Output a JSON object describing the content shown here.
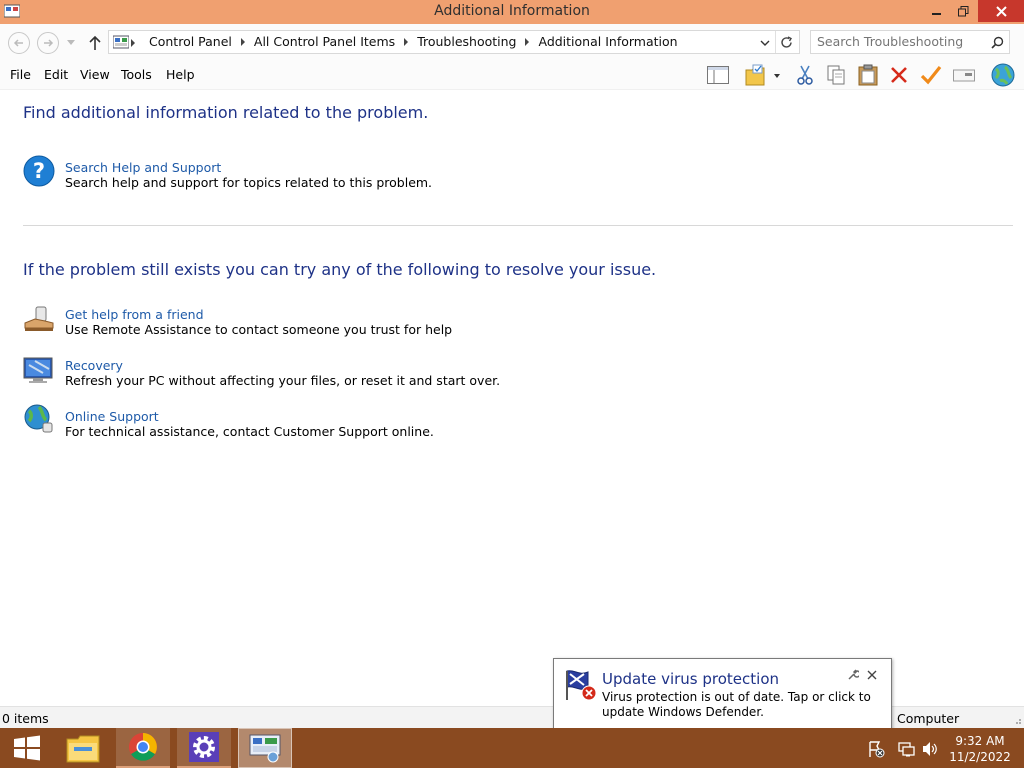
{
  "window": {
    "title": "Additional Information"
  },
  "address": {
    "breadcrumbs": [
      "Control Panel",
      "All Control Panel Items",
      "Troubleshooting",
      "Additional Information"
    ],
    "search_placeholder": "Search Troubleshooting"
  },
  "menu": {
    "items": [
      "File",
      "Edit",
      "View",
      "Tools",
      "Help"
    ]
  },
  "toolbar": {
    "icons": [
      "layout-icon",
      "folder-properties-icon",
      "cut-icon",
      "copy-icon",
      "paste-icon",
      "delete-icon",
      "check-icon",
      "rename-icon",
      "globe-icon"
    ]
  },
  "content": {
    "heading1": "Find additional information related to the problem.",
    "heading2": "If the problem still exists you can try any of the following to resolve your issue.",
    "tasks": [
      {
        "link": "Search Help and Support",
        "desc": "Search help and support for topics related to this problem.",
        "icon": "help-icon"
      },
      {
        "link": "Get help from a friend",
        "desc": "Use Remote Assistance to contact someone you trust for help",
        "icon": "remote-assistance-icon"
      },
      {
        "link": "Recovery",
        "desc": "Refresh your PC without affecting your files, or reset it and start over.",
        "icon": "recovery-icon"
      },
      {
        "link": "Online Support",
        "desc": "For technical assistance, contact Customer Support online.",
        "icon": "online-support-icon"
      }
    ]
  },
  "status": {
    "items_count": "0 items",
    "location": "Computer"
  },
  "notification": {
    "title": "Update virus protection",
    "body": "Virus protection is out of date. Tap or click to update Windows Defender."
  },
  "taskbar": {
    "time": "9:32 AM",
    "date": "11/2/2022"
  },
  "colors": {
    "titlebar": "#f0a070",
    "taskbar": "#8a4a20",
    "heading": "#1e3287",
    "link": "#1e5aa8",
    "close": "#c7372c"
  }
}
